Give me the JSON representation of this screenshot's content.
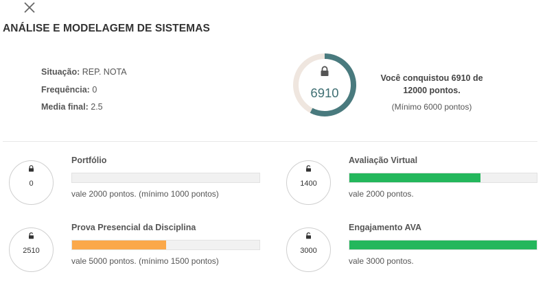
{
  "course_title": "ANÁLISE E MODELAGEM DE SISTEMAS",
  "summary": {
    "situacao_label": "Situação:",
    "situacao_value": "REP. NOTA",
    "frequencia_label": "Frequência:",
    "frequencia_value": "0",
    "media_label": "Media final:",
    "media_value": "2.5"
  },
  "score": {
    "value": "6910",
    "earned": 6910,
    "total": 12000,
    "line1": "Você conquistou 6910 de",
    "line2": "12000 pontos.",
    "minimum_note": "(Mínimo 6000 pontos)",
    "ring_color": "#497a7e",
    "ring_track_color": "#efe6df"
  },
  "activities": [
    {
      "name": "Portfólio",
      "points": "0",
      "note": "vale 2000 pontos. (mínimo 1000 pontos)",
      "progress": 0.0,
      "bar_color": "#27b560"
    },
    {
      "name": "Avaliação Virtual",
      "points": "1400",
      "note": "vale 2000 pontos.",
      "progress": 0.7,
      "bar_color": "#24b75c"
    },
    {
      "name": "Prova Presencial da Disciplina",
      "points": "2510",
      "note": "vale 5000 pontos. (mínimo 1500 pontos)",
      "progress": 0.502,
      "bar_color": "#fba84a"
    },
    {
      "name": "Engajamento AVA",
      "points": "3000",
      "note": "vale 3000 pontos.",
      "progress": 1.0,
      "bar_color": "#24b75c"
    }
  ],
  "icons": {
    "close": "close-icon",
    "lock": "lock-icon",
    "unlock": "unlock-icon"
  }
}
